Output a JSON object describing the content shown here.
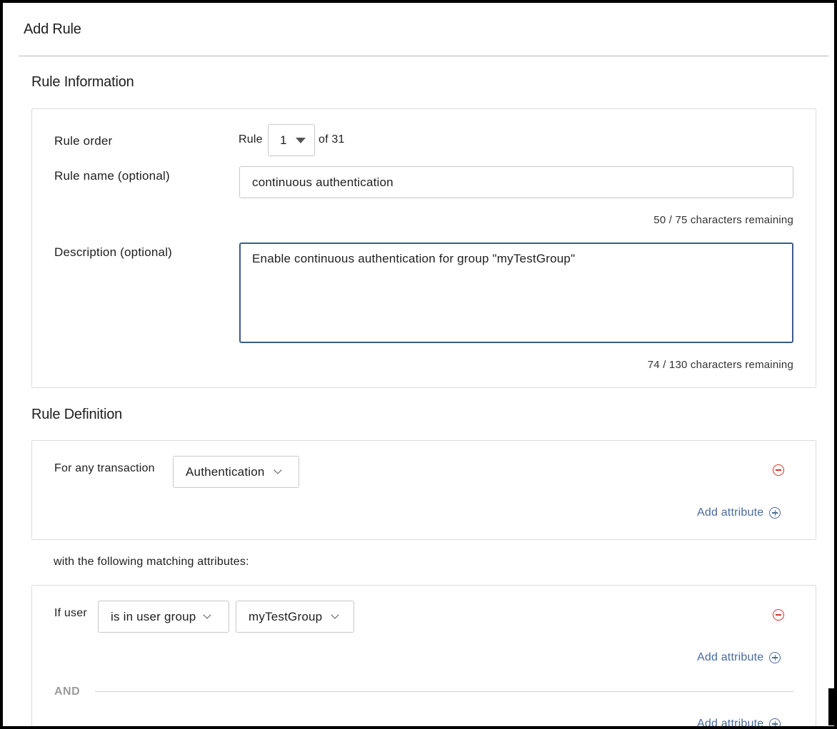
{
  "page": {
    "title": "Add Rule"
  },
  "rule_information": {
    "title": "Rule Information",
    "order_label": "Rule order",
    "order_prefix": "Rule",
    "order_value": "1",
    "order_suffix": "of 31",
    "name_label": "Rule name (optional)",
    "name_value": "continuous authentication",
    "name_counter": "50 / 75 characters remaining",
    "description_label": "Description (optional)",
    "description_value": "Enable continuous authentication for group \"myTestGroup\"",
    "description_counter": "74 / 130 characters remaining"
  },
  "rule_definition": {
    "title": "Rule Definition",
    "transaction_label": "For any transaction",
    "transaction_value": "Authentication",
    "add_attribute": "Add attribute",
    "matching_text": "with the following matching attributes:",
    "condition": {
      "label": "If user",
      "operator": "is in user group",
      "value": "myTestGroup",
      "add_attribute": "Add attribute"
    },
    "and_label": "AND",
    "partial_add_attribute": "Add attribute"
  },
  "colors": {
    "accent": "#4a6a9c",
    "remove": "#d9302c",
    "focus_border": "#3d5a8a"
  }
}
